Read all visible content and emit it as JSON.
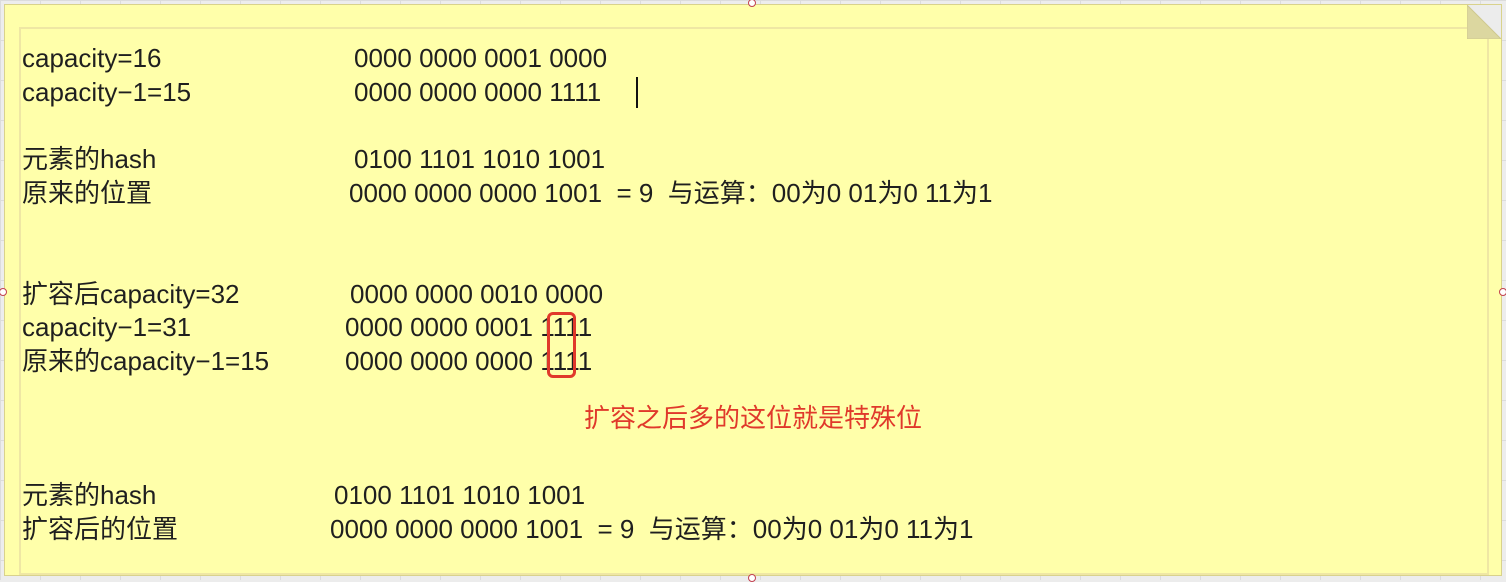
{
  "rows": {
    "r1": {
      "label": "capacity=16",
      "value": "0000 0000 0001 0000"
    },
    "r2": {
      "label": "capacity−1=15",
      "value": "0000 0000 0000 1111"
    },
    "r3": {
      "label": "元素的hash",
      "value": "0100 1101 1010 1001"
    },
    "r4": {
      "label": "原来的位置",
      "value": "0000 0000 0000 1001  = 9  与运算：00为0 01为0 11为1"
    },
    "r5": {
      "label": "扩容后capacity=32",
      "value": "0000 0000 0010 0000"
    },
    "r6": {
      "label": "capacity−1=31",
      "value": "0000 0000 0001 1111"
    },
    "r7": {
      "label": "原来的capacity−1=15",
      "value": "0000 0000 0000 1111"
    },
    "r8": {
      "label": "元素的hash",
      "value": "0100 1101 1010 1001"
    },
    "r9": {
      "label": "扩容后的位置",
      "value": "0000 0000 0000 1001  = 9  与运算：00为0 01为0 11为1"
    }
  },
  "annotation": "扩容之后多的这位就是特殊位",
  "colors": {
    "note_background": "#ffffaa",
    "annotation_red": "#e0392b",
    "text": "#1f1f1f"
  }
}
